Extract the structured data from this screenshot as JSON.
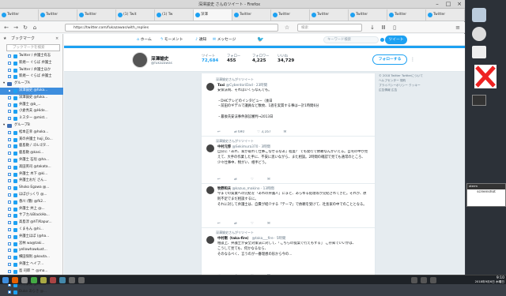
{
  "window": {
    "title": "深澤諭史 さんのツイート - Firefox"
  },
  "tabs": [
    {
      "label": "Twitter"
    },
    {
      "label": "Twitter"
    },
    {
      "label": "Twitter"
    },
    {
      "label": "(1) Twit"
    },
    {
      "label": "(1) Tw"
    },
    {
      "label": "深澤"
    },
    {
      "label": "Twitter"
    },
    {
      "label": "Twitter"
    },
    {
      "label": "Twitter"
    },
    {
      "label": "Twitter"
    },
    {
      "label": "Twitter"
    },
    {
      "label": "Twitter"
    }
  ],
  "nav": {
    "url": "https://twitter.com/fukazawas/with_replies",
    "search_placeholder": "検索"
  },
  "sidebar": {
    "title": "ブックマーク",
    "search_placeholder": "ブックマークを検索",
    "items": [
      {
        "label": "Twitter / 弁護士有志",
        "type": "item",
        "indent": 1
      },
      {
        "label": "新規一 ぐらば 弁護士",
        "type": "item",
        "indent": 1
      },
      {
        "label": "Twitter / 弁護士ほか",
        "type": "item",
        "indent": 1
      },
      {
        "label": "新規一 ぐらば 弁護士",
        "type": "item",
        "indent": 1
      },
      {
        "label": "グループA",
        "type": "folder",
        "indent": 0
      },
      {
        "label": "深澤諭史 @fuka...",
        "type": "item",
        "indent": 1,
        "selected": true
      },
      {
        "label": "深澤諭史 @fuka...",
        "type": "item",
        "indent": 1
      },
      {
        "label": "弁護士 @b_...",
        "type": "item",
        "indent": 1
      },
      {
        "label": "小倉秀夫 @Hide...",
        "type": "item",
        "indent": 1
      },
      {
        "label": "ミスター @mist...",
        "type": "item",
        "indent": 1
      },
      {
        "label": "グループB",
        "type": "folder",
        "indent": 0
      },
      {
        "label": "松本正幸 @hoka...",
        "type": "item",
        "indent": 1
      },
      {
        "label": "某の弁護士 hoji_Oo...",
        "type": "item",
        "indent": 1
      },
      {
        "label": "鹿島勲 / ゴルゴタ...",
        "type": "item",
        "indent": 1
      },
      {
        "label": "鹿島勲 @kasi...",
        "type": "item",
        "indent": 1
      },
      {
        "label": "弁護士 石垣 @ha...",
        "type": "item",
        "indent": 1
      },
      {
        "label": "高田英司 @takata...",
        "type": "item",
        "indent": 1
      },
      {
        "label": "弁護士 木下 @ki...",
        "type": "item",
        "indent": 1
      },
      {
        "label": "弁護士おだ さん...",
        "type": "item",
        "indent": 1
      },
      {
        "label": "Shoko Egawa @...",
        "type": "item",
        "indent": 1
      },
      {
        "label": "ほぼびっくり @...",
        "type": "item",
        "indent": 1
      },
      {
        "label": "香川 (簡) @fk2...",
        "type": "item",
        "indent": 1
      },
      {
        "label": "弁護士 井上 @...",
        "type": "item",
        "indent": 1
      },
      {
        "label": "サブカルBlackHa...",
        "type": "item",
        "indent": 1
      },
      {
        "label": "高島淳 @hT/Kapur...",
        "type": "item",
        "indent": 1
      },
      {
        "label": "くまもん @hi...",
        "type": "item",
        "indent": 1
      },
      {
        "label": "弁護士ほぼ (@ha...",
        "type": "item",
        "indent": 1
      },
      {
        "label": "宮林 wa@taki...",
        "type": "item",
        "indent": 1
      },
      {
        "label": "yellowhawkust...",
        "type": "item",
        "indent": 1
      },
      {
        "label": "横田保則 @kouta...",
        "type": "item",
        "indent": 1
      },
      {
        "label": "弁護士 ヘイブ...",
        "type": "item",
        "indent": 1
      },
      {
        "label": "島 司郎 ™ @ma...",
        "type": "item",
        "indent": 1
      },
      {
        "label": "井上道夫 @hyino...",
        "type": "item",
        "indent": 1
      },
      {
        "label": "町村泰貴 @masa...",
        "type": "item",
        "indent": 1
      },
      {
        "label": "Duke あらき @...",
        "type": "item",
        "indent": 1
      }
    ]
  },
  "twitter": {
    "nav": {
      "home": "ホーム",
      "moments": "モーメント",
      "notifications": "通知",
      "messages": "メッセージ",
      "search_placeholder": "キーワード検索",
      "tweet_button": "ツイート"
    },
    "profile": {
      "name": "深澤諭史",
      "handle": "@fukazawas",
      "stats": [
        {
          "label": "ツイート",
          "value": "72,684",
          "active": true
        },
        {
          "label": "フォロー",
          "value": "455"
        },
        {
          "label": "フォロワー",
          "value": "4,225"
        },
        {
          "label": "いいね",
          "value": "34,729"
        }
      ],
      "follow_button": "フォローする"
    },
    "tweets": [
      {
        "context": "深澤諭史さんがリツイート",
        "name": "Taxi",
        "handle": "@CyberdoriDad · 23時間",
        "body": "安保法制、それはいくらなんでも。\n\n・DHCテレビのインタビュー（後日\n・前田のギデルで議員など数枚、1週を実質する事は一計1時間6分\n\n・最後氏安法事件訴訟審判→2013日",
        "replies": "",
        "retweets": "690",
        "likes": "3,167"
      },
      {
        "context": "深澤諭史さんがリツイート",
        "name": "中村元弥",
        "handle": "@Sekimura370 · 3時間",
        "body": "自分に「あれ、家が取れて仕事こなせるなあ」程度？ でも発行で依頼なんかいえる。自宅の中が見えて、大手の作業した手に、不安に思いながら、また相談。2時間の確認で見ても通常のところ、少々仕事中、物がい、相手どう。",
        "replies": "",
        "retweets": "",
        "likes": ""
      },
      {
        "context": "",
        "name": "牧野和夫",
        "handle": "@kazuo_makino · 13時間",
        "body": "今までの質業への完結を「あれの弁護人」にまと、あらゆる処理等が完結されてきた。それが、原則不足でまだ相談するに。\nそれに対して弁護士は、自費が紹介する「テーマ」で依頼を受けて、社長家の中でのこととなる。",
        "replies": "",
        "retweets": "",
        "likes": ""
      },
      {
        "context": "深澤諭史さんがリツイート",
        "name": "中村剛（taka-fire）",
        "handle": "@taka___fire · 5時間",
        "body": "相談上、弁護士が安全対策法に対して、「こちらの提案で行えもする」 ご存知でいいかは、\nこうして見ても、何かなるなら、\nそのなるべく、言うのが一番理想の形から今の...",
        "replies": "",
        "retweets": "",
        "likes": ""
      }
    ],
    "right": [
      "© 2018 Twitter  Twitterについて",
      "ヘルプセンター  規約",
      "プライバシーポリシー  クッキー",
      "広告情報  広告"
    ]
  },
  "desktop": {
    "icons": [
      {
        "label": "ホーム"
      },
      {
        "label": ""
      },
      {
        "label": ""
      },
      {
        "label": ""
      }
    ],
    "terminal_title": "xterm",
    "terminal_text": "screenshot"
  },
  "taskbar": {
    "time": "9:10",
    "date": "2018年9月6日 木曜日"
  }
}
